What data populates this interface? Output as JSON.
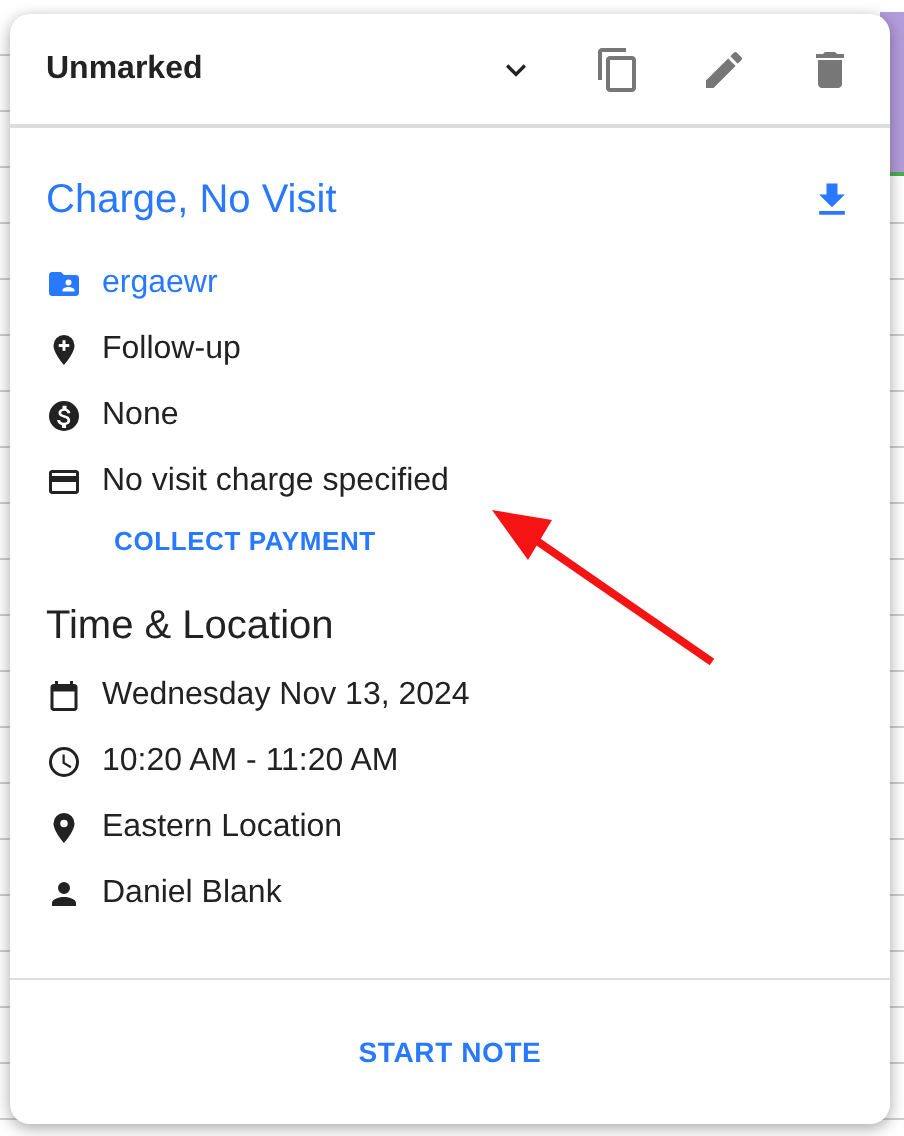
{
  "header": {
    "status": "Unmarked"
  },
  "appointment": {
    "title": "Charge, No Visit",
    "details": [
      {
        "kind": "patient",
        "text": "ergaewr"
      },
      {
        "kind": "visit-type",
        "text": "Follow-up"
      },
      {
        "kind": "billing",
        "text": "None"
      },
      {
        "kind": "payment",
        "text": "No visit charge specified"
      }
    ],
    "action": "COLLECT PAYMENT"
  },
  "time_location": {
    "heading": "Time & Location",
    "items": [
      {
        "kind": "date",
        "text": "Wednesday Nov 13, 2024"
      },
      {
        "kind": "time",
        "text": "10:20 AM - 11:20 AM"
      },
      {
        "kind": "location",
        "text": "Eastern Location"
      },
      {
        "kind": "provider",
        "text": "Daniel Blank"
      }
    ]
  },
  "footer": {
    "button": "START NOTE"
  }
}
